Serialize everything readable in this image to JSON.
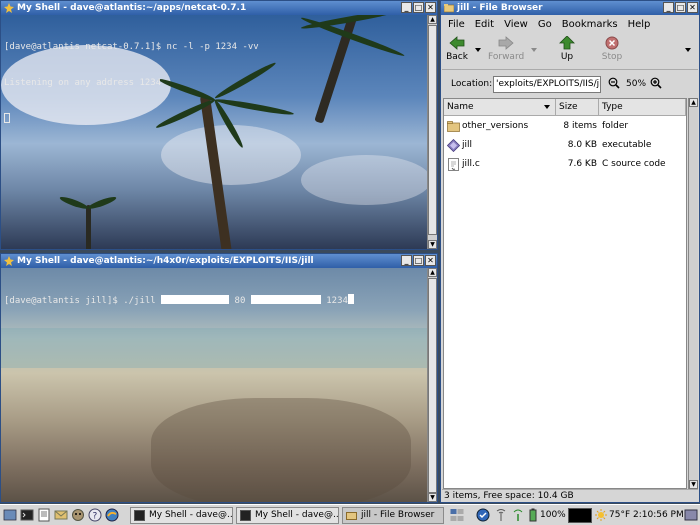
{
  "term1": {
    "title": "My Shell - dave@atlantis:~/apps/netcat-0.7.1",
    "lines": [
      "[dave@atlantis netcat-0.7.1]$ nc -l -p 1234 -vv",
      "Listening on any address 1234"
    ]
  },
  "term2": {
    "title": "My Shell - dave@atlantis:~/h4x0r/exploits/EXPLOITS/IIS/jill",
    "prompt": "[dave@atlantis jill]$ ./jill ",
    "arg1": " 80 ",
    "arg2": " 1234"
  },
  "browser": {
    "title": "jill - File Browser",
    "menu": [
      "File",
      "Edit",
      "View",
      "Go",
      "Bookmarks",
      "Help"
    ],
    "toolbar": {
      "back": "Back",
      "forward": "Forward",
      "up": "Up",
      "stop": "Stop"
    },
    "location_label": "Location:",
    "location_value": "'exploits/EXPLOITS/IIS/jill",
    "zoom": "50%",
    "columns": {
      "name": "Name",
      "size": "Size",
      "type": "Type"
    },
    "files": [
      {
        "name": "other_versions",
        "size": "8 items",
        "type": "folder",
        "icon": "folder-icon"
      },
      {
        "name": "jill",
        "size": "8.0 KB",
        "type": "executable",
        "icon": "executable-icon"
      },
      {
        "name": "jill.c",
        "size": "7.6 KB",
        "type": "C source code",
        "icon": "c-source-icon"
      }
    ],
    "status": "3 items, Free space: 10.4 GB"
  },
  "taskbar": {
    "tasks": [
      "My Shell - dave@...",
      "My Shell - dave@...",
      "jill - File Browser"
    ],
    "battery": "100%",
    "weather": "75°F",
    "clock": "2:10:56 PM"
  },
  "colors": {
    "title_active": "#3b6cb5",
    "desktop": "#3a4a5c"
  }
}
